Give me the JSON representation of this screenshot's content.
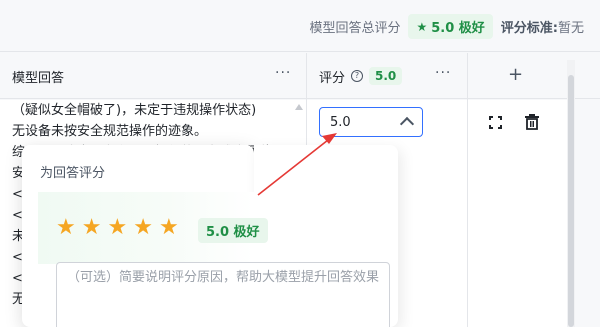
{
  "summary": {
    "label": "模型回答总评分",
    "score_badge": "5.0 极好",
    "criteria_label": "评分标准:",
    "criteria_value": "暂无"
  },
  "table": {
    "col_answer": "模型回答",
    "col_score": "评分",
    "col_score_badge": "5.0",
    "more": "···",
    "add": "+"
  },
  "answer_lines": "（疑似女全帽破了)，未定于违规操作状态)\n无设备未按安全规范操作的迹象。\n综上，图片中不存在违规操作的设备或未佩戴\n安\n</\n<类\n未\n</\n<论\n无",
  "score_select": {
    "value": "5.0"
  },
  "popover": {
    "title": "为回答评分",
    "rating_badge": "5.0 极好",
    "star_count": 5,
    "reason_placeholder": "（可选）简要说明评分原因，帮助大模型提升回答效果"
  },
  "colors": {
    "accent_green": "#1f8f46",
    "star": "#f5a623",
    "focus_blue": "#3370ff",
    "annotation_red": "#e53935"
  }
}
